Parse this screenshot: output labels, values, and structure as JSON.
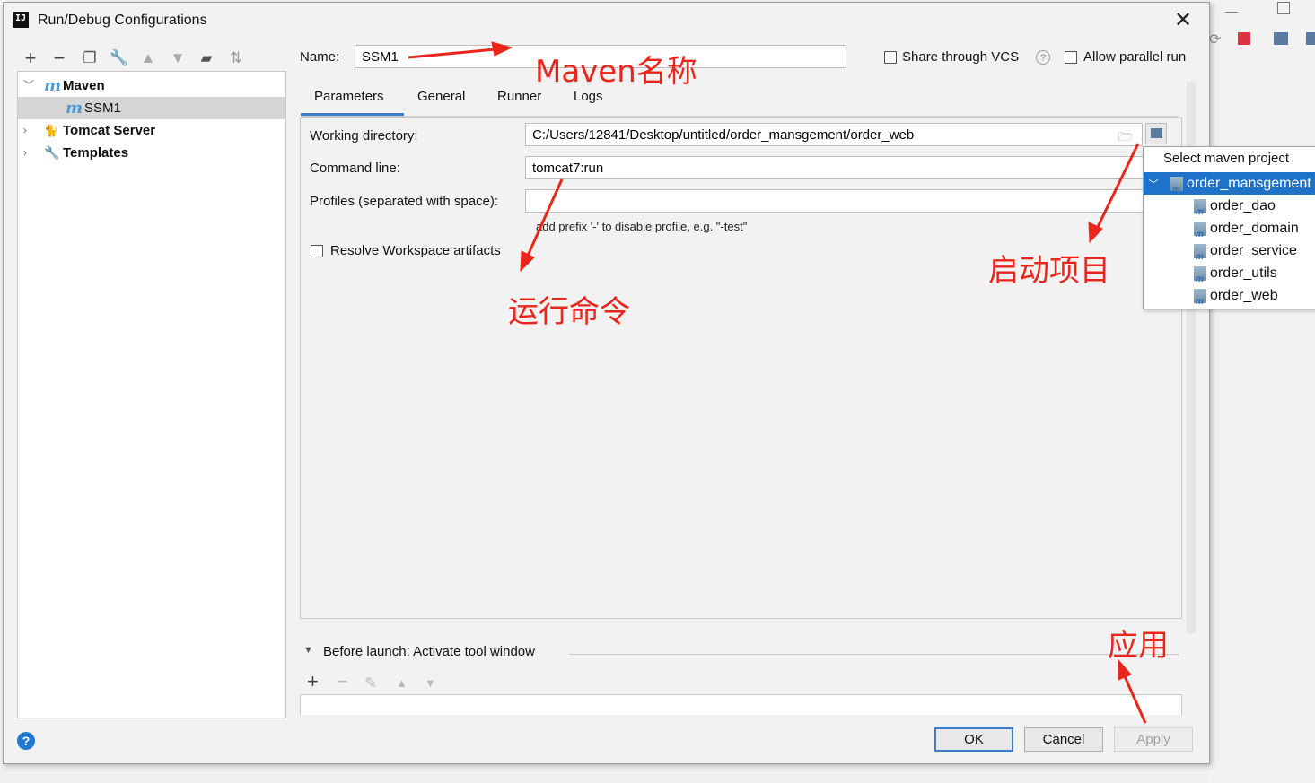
{
  "dialog": {
    "title": "Run/Debug Configurations"
  },
  "toolbar": {
    "icons": [
      "add-icon",
      "remove-icon",
      "copy-icon",
      "wrench-icon",
      "move-up-icon",
      "move-down-icon",
      "folder-add-icon",
      "sort-icon"
    ]
  },
  "tree": {
    "items": [
      {
        "label": "Maven",
        "icon": "maven-icon",
        "expanded": true
      },
      {
        "label": "SSM1",
        "icon": "maven-icon"
      },
      {
        "label": "Tomcat Server",
        "icon": "tomcat-icon"
      },
      {
        "label": "Templates",
        "icon": "wrench-icon"
      }
    ]
  },
  "form": {
    "name_label": "Name:",
    "name_value": "SSM1",
    "share_vcs_label": "Share through VCS",
    "help_mark": "?",
    "parallel_label": "Allow parallel run"
  },
  "tabs": [
    {
      "label": "Parameters",
      "active": true
    },
    {
      "label": "General"
    },
    {
      "label": "Runner"
    },
    {
      "label": "Logs"
    }
  ],
  "params": {
    "working_dir_label": "Working directory:",
    "working_dir_value": "C:/Users/12841/Desktop/untitled/order_mansgement/order_web",
    "command_label": "Command line:",
    "command_value": "tomcat7:run",
    "profiles_label": "Profiles (separated with space):",
    "profiles_value": "",
    "profiles_hint": "add prefix '-' to disable profile, e.g. \"-test\"",
    "resolve_label": "Resolve Workspace artifacts"
  },
  "popup": {
    "title": "Select maven project",
    "items": [
      {
        "label": "order_mansgement",
        "selected": true
      },
      {
        "label": "order_dao"
      },
      {
        "label": "order_domain"
      },
      {
        "label": "order_service"
      },
      {
        "label": "order_utils"
      },
      {
        "label": "order_web"
      }
    ]
  },
  "before_launch": {
    "label": "Before launch: Activate tool window"
  },
  "buttons": {
    "ok": "OK",
    "cancel": "Cancel",
    "apply": "Apply",
    "help": "?"
  },
  "annotations": {
    "maven_name": "Maven名称",
    "run_command": "运行命令",
    "start_project": "启动项目",
    "apply": "应用",
    "color": "#e8261b"
  }
}
